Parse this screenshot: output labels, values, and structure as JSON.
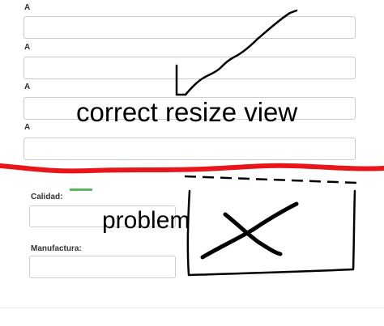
{
  "form_top": {
    "fields": [
      {
        "label": "A",
        "value": ""
      },
      {
        "label": "A",
        "value": ""
      },
      {
        "label": "A",
        "value": ""
      },
      {
        "label": "A",
        "value": ""
      }
    ]
  },
  "form_bottom": {
    "calidad_label": "Calidad:",
    "calidad_value": "",
    "manufactura_label": "Manufactura:",
    "manufactura_value": ""
  },
  "annotations": {
    "correct_text": "correct resize view",
    "problem_text": "problem",
    "divider_color": "#e8151b",
    "ink_color": "#000000",
    "status_color": "#5cb85c"
  }
}
